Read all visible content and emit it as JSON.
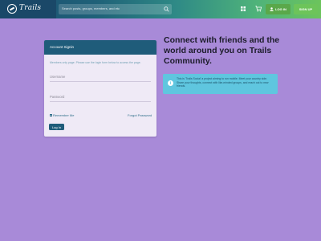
{
  "header": {
    "logo_text": "Trails",
    "search_placeholder": "Search posts, groups, members, and etc",
    "login_label": "LOG IN",
    "signup_label": "SIGN UP"
  },
  "signin": {
    "title": "Account Signin",
    "note": "Members only page. Please use the login form below to access the page.",
    "username_placeholder": "Username",
    "password_placeholder": "Password",
    "remember_label": "Remember Me",
    "forgot_label": "Forgot Password",
    "submit_label": "Log In"
  },
  "hero": {
    "headline": "Connect with friends and the world around you on Trails Community.",
    "info_text": "This is 'Trails Social' a project aiming to run mobile. Meet your country side. Share your thoughts, connect with like-minded groups, and reach out to new friends."
  },
  "colors": {
    "page_bg": "#a88ad8",
    "header_dark": "#1a4868",
    "accent_green": "#5aa84a",
    "card_header": "#1f5c7a",
    "info_bg": "#5fc6df"
  }
}
